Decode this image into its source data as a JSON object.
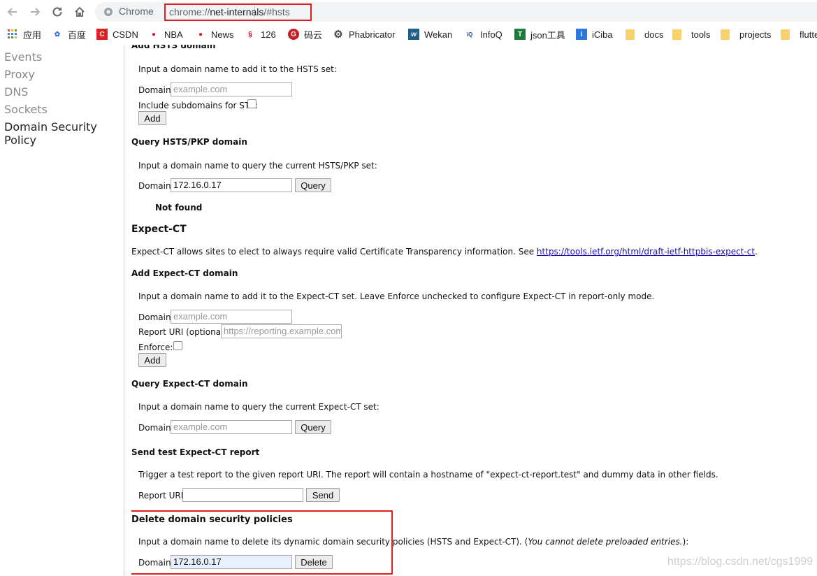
{
  "browser": {
    "omnibox_scheme_label": "Chrome",
    "url_scheme": "chrome://",
    "url_host": "net-internals",
    "url_path": "/#hsts"
  },
  "bookmarks": [
    {
      "label": "应用",
      "icon": "apps-grid-icon"
    },
    {
      "label": "百度",
      "icon": "baidu-paw-icon"
    },
    {
      "label": "CSDN",
      "icon": "csdn-icon"
    },
    {
      "label": "NBA",
      "icon": "weibo-icon"
    },
    {
      "label": "News",
      "icon": "weibo-icon"
    },
    {
      "label": "126",
      "icon": "netease-icon"
    },
    {
      "label": "码云",
      "icon": "gitee-icon"
    },
    {
      "label": "Phabricator",
      "icon": "phabricator-gear-icon"
    },
    {
      "label": "Wekan",
      "icon": "wekan-icon"
    },
    {
      "label": "InfoQ",
      "icon": "infoq-icon"
    },
    {
      "label": "json工具",
      "icon": "json-tool-icon"
    },
    {
      "label": "iCiba",
      "icon": "iciba-icon"
    },
    {
      "label": "docs",
      "icon": "folder-icon"
    },
    {
      "label": "tools",
      "icon": "folder-icon"
    },
    {
      "label": "projects",
      "icon": "folder-icon"
    },
    {
      "label": "flutte",
      "icon": "folder-icon"
    }
  ],
  "sidebar": {
    "items": [
      {
        "label": "Events"
      },
      {
        "label": "Proxy"
      },
      {
        "label": "DNS"
      },
      {
        "label": "Sockets"
      },
      {
        "label": "Domain Security Policy"
      }
    ]
  },
  "hsts_add": {
    "heading_partial": "Add HSTS domain",
    "description": "Input a domain name to add it to the HSTS set:",
    "domain_label": "Domain:",
    "domain_placeholder": "example.com",
    "subdomains_label": "Include subdomains for STS:",
    "add_button": "Add"
  },
  "hsts_query": {
    "heading": "Query HSTS/PKP domain",
    "description": "Input a domain name to query the current HSTS/PKP set:",
    "domain_label": "Domain:",
    "domain_value": "172.16.0.17",
    "query_button": "Query",
    "result": "Not found"
  },
  "expect_ct": {
    "heading": "Expect-CT",
    "description": "Expect-CT allows sites to elect to always require valid Certificate Transparency information. See",
    "link_text": "https://tools.ietf.org/html/draft-ietf-httpbis-expect-ct",
    "description_end": "."
  },
  "expect_ct_add": {
    "heading": "Add Expect-CT domain",
    "description": "Input a domain name to add it to the Expect-CT set. Leave Enforce unchecked to configure Expect-CT in report-only mode.",
    "domain_label": "Domain:",
    "domain_placeholder": "example.com",
    "report_uri_label": "Report URI (optional):",
    "report_uri_placeholder": "https://reporting.example.com",
    "enforce_label": "Enforce:",
    "add_button": "Add"
  },
  "expect_ct_query": {
    "heading": "Query Expect-CT domain",
    "description": "Input a domain name to query the current Expect-CT set:",
    "domain_label": "Domain:",
    "domain_placeholder": "example.com",
    "query_button": "Query"
  },
  "expect_ct_test": {
    "heading": "Send test Expect-CT report",
    "description": "Trigger a test report to the given report URI. The report will contain a hostname of \"expect-ct-report.test\" and dummy data in other fields.",
    "report_uri_label": "Report URI:",
    "report_uri_value": "",
    "send_button": "Send"
  },
  "delete_policies": {
    "heading": "Delete domain security policies",
    "description": "Input a domain name to delete its dynamic domain security policies (HSTS and Expect-CT). (",
    "note": "You cannot delete preloaded entries.",
    "description_end": "):",
    "domain_label": "Domain:",
    "domain_value": "172.16.0.17",
    "delete_button": "Delete"
  },
  "watermark": "https://blog.csdn.net/cgs1999",
  "colors": {
    "highlight_border": "#e02020",
    "link": "#1a0dab",
    "folder": "#f8d16c"
  }
}
